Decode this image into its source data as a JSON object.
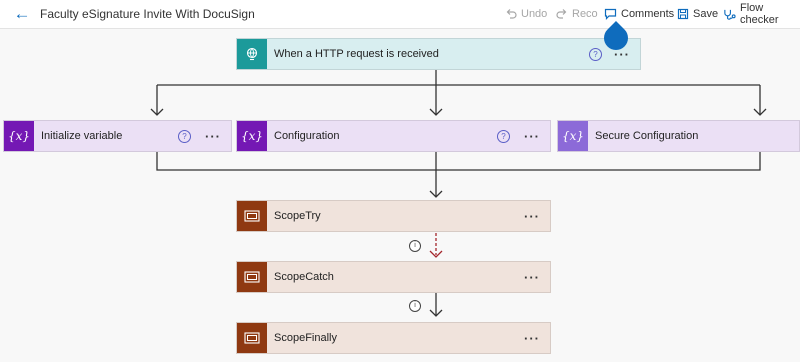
{
  "header": {
    "title": "Faculty eSignature Invite With DocuSign",
    "undo": "Undo",
    "redo": "Reco",
    "comments": "Comments",
    "save": "Save",
    "flow_checker": "Flow checker"
  },
  "trigger": {
    "label": "When a HTTP request is received",
    "help": "?",
    "more": "···"
  },
  "actions": [
    {
      "label": "Initialize variable",
      "icon": "{x}",
      "help": "?",
      "more": "···"
    },
    {
      "label": "Configuration",
      "icon": "{x}",
      "help": "?",
      "more": "···"
    },
    {
      "label": "Secure Configuration",
      "icon": "{x}"
    }
  ],
  "scopes": [
    {
      "label": "ScopeTry",
      "more": "···"
    },
    {
      "label": "ScopeCatch",
      "more": "···"
    },
    {
      "label": "ScopeFinally",
      "more": "···"
    }
  ],
  "info_glyph": "i",
  "colors": {
    "accent": "#0f6cbd",
    "trigger_icon": "#1c9a9a",
    "variable_icon": "#7418b4",
    "secure_icon": "#8c6ad8",
    "scope_icon": "#8f3911",
    "error_arrow": "#a4262c"
  }
}
